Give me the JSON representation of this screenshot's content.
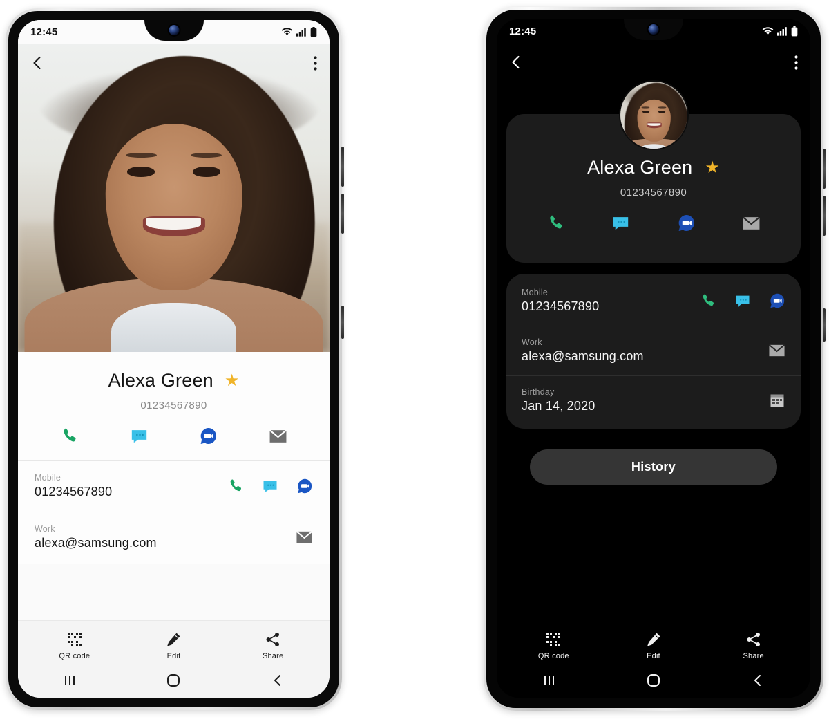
{
  "phones": {
    "light": {
      "theme_label": "light",
      "status": {
        "time": "12:45",
        "wifi": "wifi-icon",
        "signal": "signal-icon",
        "battery": "battery-icon"
      },
      "appbar": {
        "back": "back-arrow-icon",
        "menu": "more-options-icon"
      },
      "contact": {
        "name": "Alexa Green",
        "favorite": "★",
        "number": "01234567890",
        "actions": [
          {
            "name": "call-action",
            "icon": "phone-icon"
          },
          {
            "name": "message-action",
            "icon": "message-icon"
          },
          {
            "name": "video-call-action",
            "icon": "duo-video-icon"
          },
          {
            "name": "email-action",
            "icon": "email-icon"
          }
        ]
      },
      "details": [
        {
          "label": "Mobile",
          "value": "01234567890",
          "icons": [
            {
              "name": "row-call-icon",
              "icon": "phone-icon"
            },
            {
              "name": "row-message-icon",
              "icon": "message-icon"
            },
            {
              "name": "row-video-icon",
              "icon": "duo-video-icon"
            }
          ]
        },
        {
          "label": "Work",
          "value": "alexa@samsung.com",
          "icons": [
            {
              "name": "row-email-icon",
              "icon": "email-icon"
            }
          ]
        }
      ],
      "toolbar": [
        {
          "label": "QR code",
          "icon": "qr-code-icon"
        },
        {
          "label": "Edit",
          "icon": "pencil-edit-icon"
        },
        {
          "label": "Share",
          "icon": "share-icon"
        }
      ],
      "navbar": [
        {
          "name": "recents-button",
          "icon": "recents-icon"
        },
        {
          "name": "home-button",
          "icon": "home-icon"
        },
        {
          "name": "back-button",
          "icon": "back-icon"
        }
      ]
    },
    "dark": {
      "theme_label": "dark",
      "status": {
        "time": "12:45",
        "wifi": "wifi-icon",
        "signal": "signal-icon",
        "battery": "battery-icon"
      },
      "appbar": {
        "back": "back-arrow-icon",
        "menu": "more-options-icon"
      },
      "contact": {
        "name": "Alexa Green",
        "favorite": "★",
        "number": "01234567890",
        "avatar": "contact-avatar-photo",
        "actions": [
          {
            "name": "call-action",
            "icon": "phone-icon"
          },
          {
            "name": "message-action",
            "icon": "message-icon"
          },
          {
            "name": "video-call-action",
            "icon": "duo-video-icon"
          },
          {
            "name": "email-action",
            "icon": "email-icon"
          }
        ]
      },
      "details": [
        {
          "label": "Mobile",
          "value": "01234567890",
          "icons": [
            {
              "name": "row-call-icon",
              "icon": "phone-icon"
            },
            {
              "name": "row-message-icon",
              "icon": "message-icon"
            },
            {
              "name": "row-video-icon",
              "icon": "duo-video-icon"
            }
          ]
        },
        {
          "label": "Work",
          "value": "alexa@samsung.com",
          "icons": [
            {
              "name": "row-email-icon",
              "icon": "email-icon"
            }
          ]
        },
        {
          "label": "Birthday",
          "value": "Jan 14, 2020",
          "icons": [
            {
              "name": "row-calendar-icon",
              "icon": "calendar-icon"
            }
          ]
        }
      ],
      "history_button": "History",
      "toolbar": [
        {
          "label": "QR code",
          "icon": "qr-code-icon"
        },
        {
          "label": "Edit",
          "icon": "pencil-edit-icon"
        },
        {
          "label": "Share",
          "icon": "share-icon"
        }
      ],
      "navbar": [
        {
          "name": "recents-button",
          "icon": "recents-icon"
        },
        {
          "name": "home-button",
          "icon": "home-icon"
        },
        {
          "name": "back-button",
          "icon": "back-icon"
        }
      ]
    }
  },
  "colors": {
    "phone_green": "#19a463",
    "phone_green_dark": "#2fbd7e",
    "message_blue": "#39c0e8",
    "duo_blue": "#1a56c4",
    "email_gray": "#6e6e6e",
    "star_gold": "#f0b429",
    "dark_card": "#1c1c1c",
    "history_btn": "#353535"
  }
}
